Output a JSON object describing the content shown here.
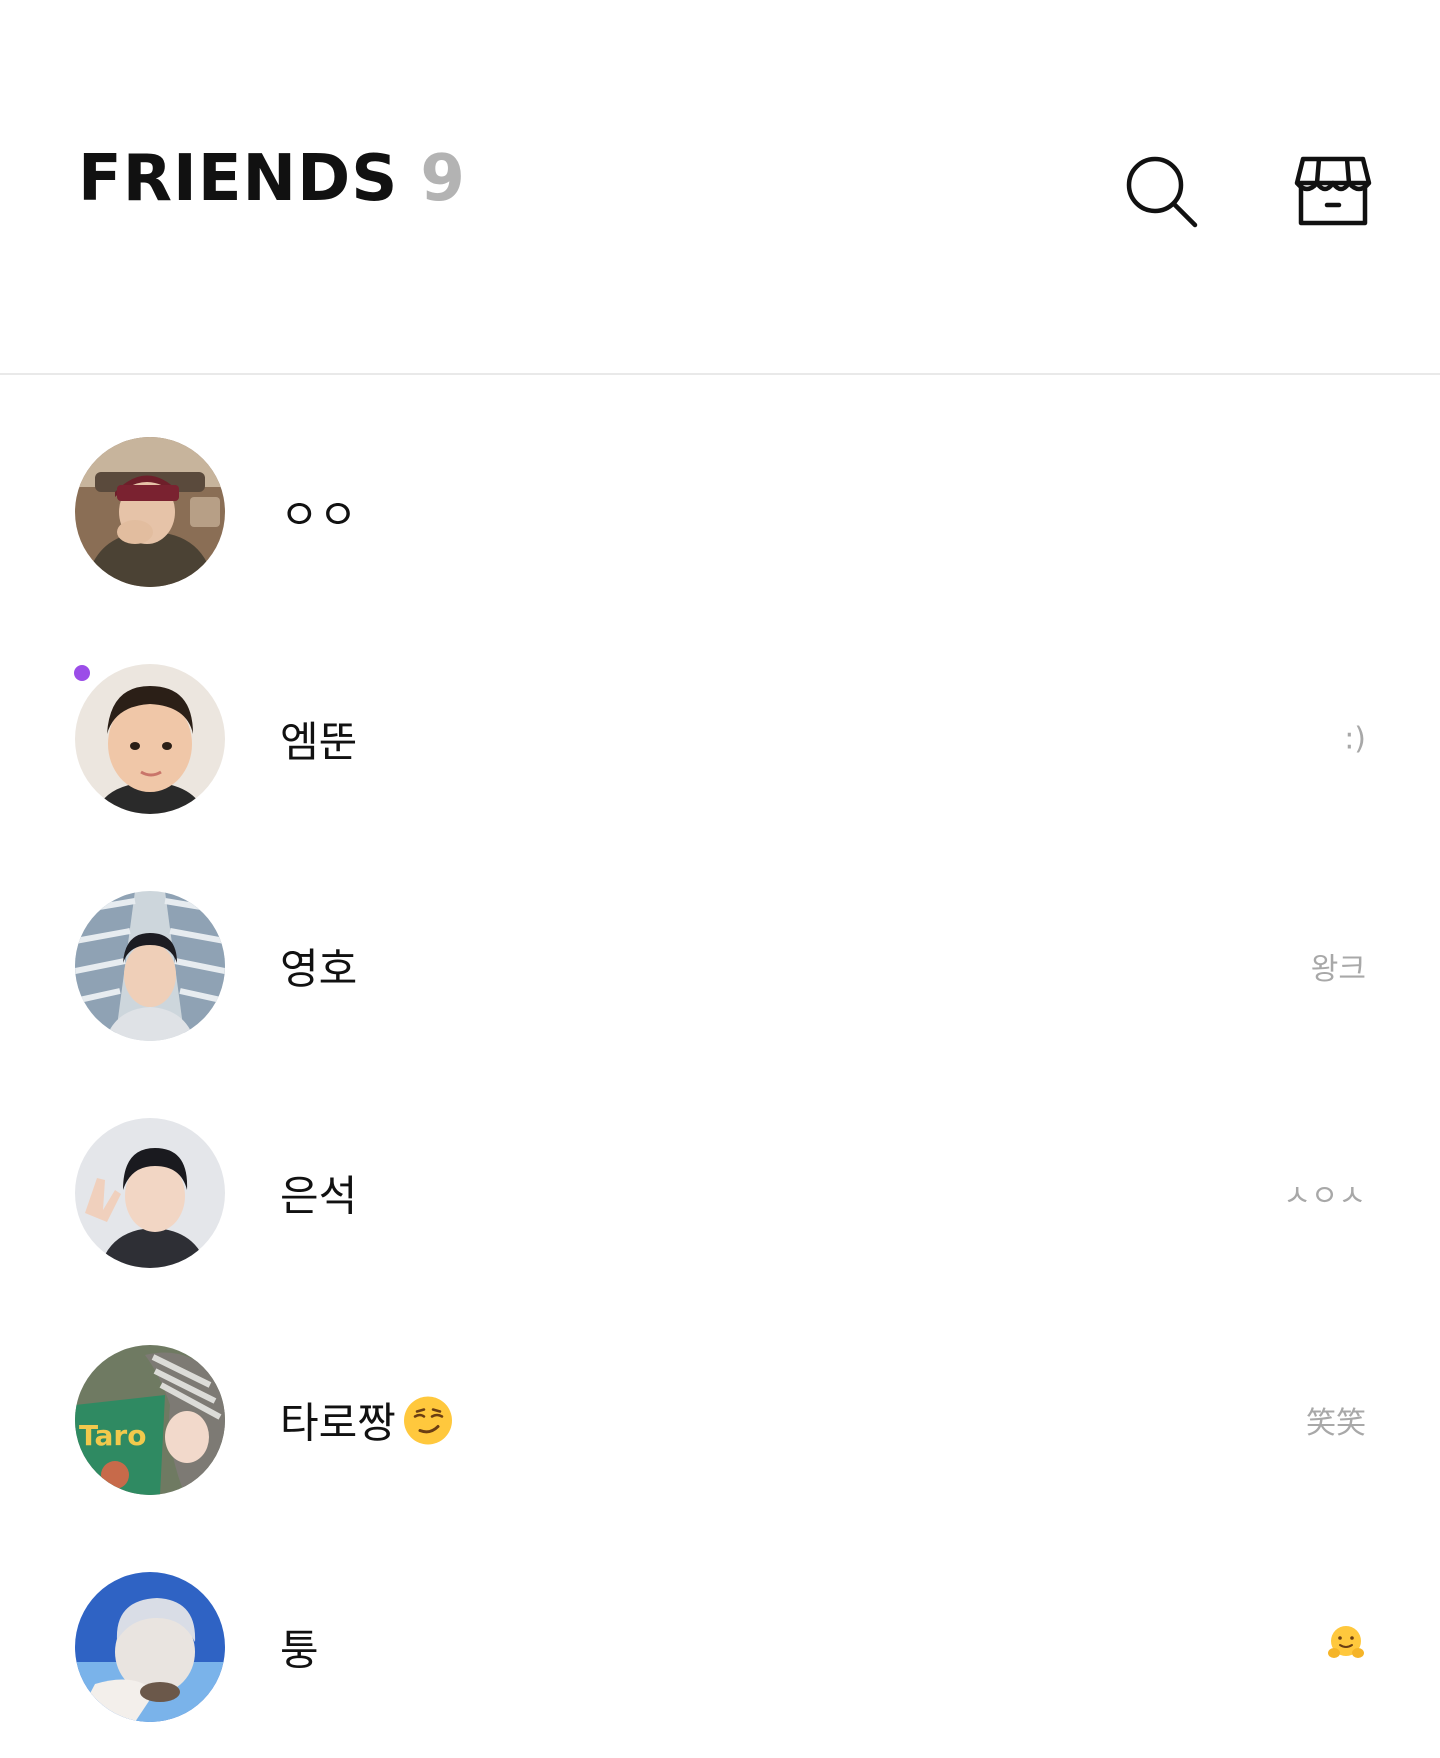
{
  "header": {
    "title": "FRIENDS",
    "count": "9",
    "search_icon": "search-icon",
    "shop_icon": "store-icon"
  },
  "friends": [
    {
      "name": "ㅇㅇ",
      "status": "",
      "avatar": "photo-man-cap-in-car",
      "has_new": false
    },
    {
      "name": "엠뚠",
      "status": ":)",
      "avatar": "photo-boy-portrait",
      "has_new": true
    },
    {
      "name": "영호",
      "status": "왕크",
      "avatar": "photo-man-striped-tent",
      "has_new": false
    },
    {
      "name": "은석",
      "status": "ㅅㅇㅅ",
      "avatar": "photo-man-peace-sign",
      "has_new": false
    },
    {
      "name": "타로짱",
      "name_emoji": "smirking-face-emoji",
      "status": "笑笑",
      "avatar": "photo-taro-snack",
      "has_new": false
    },
    {
      "name": "퉁",
      "status": "",
      "status_emoji": "hugging-face-emoji",
      "avatar": "photo-silver-hair-sky",
      "has_new": false
    }
  ],
  "colors": {
    "accent_dot": "#9b4de8",
    "status_text": "#a8a8a8",
    "count_text": "#b3b3b3"
  }
}
